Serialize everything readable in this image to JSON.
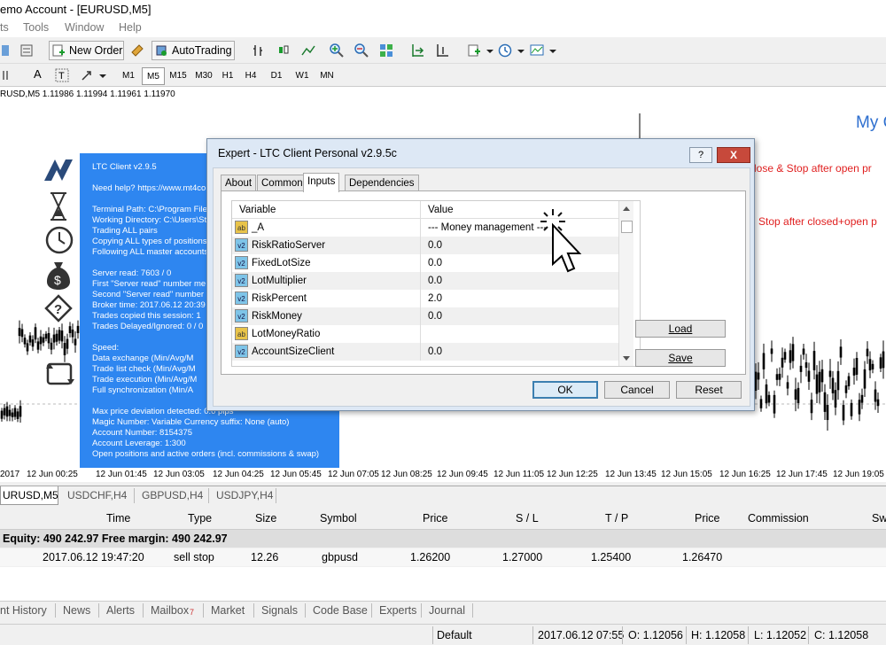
{
  "window": {
    "title": "emo Account - [EURUSD,M5]"
  },
  "menu": [
    "ts",
    "Tools",
    "Window",
    "Help"
  ],
  "toolbar": {
    "new_order": "New Order",
    "autotrading": "AutoTrading"
  },
  "timeframes": [
    "M1",
    "M5",
    "M15",
    "M30",
    "H1",
    "H4",
    "D1",
    "W1",
    "MN"
  ],
  "active_timeframe": "M5",
  "chart": {
    "header": "RUSD,M5  1.11986 1.11994 1.11961 1.11970",
    "right_title": "My C",
    "right_line1": "lose & Stop after open pr",
    "right_line2": "Stop after closed+open p",
    "time_labels": [
      "2017",
      "12 Jun 00:25",
      "12 Jun 01:45",
      "12 Jun 03:05",
      "12 Jun 04:25",
      "12 Jun 05:45",
      "12 Jun 07:05",
      "12 Jun 08:25",
      "12 Jun 09:45",
      "12 Jun 11:05",
      "12 Jun 12:25",
      "12 Jun 13:45",
      "12 Jun 15:05",
      "12 Jun 16:25",
      "12 Jun 17:45",
      "12 Jun 19:05"
    ],
    "colors": {
      "info_panel": "#2e86f0",
      "right_text": "#e02020",
      "right_title": "#2e6fcf"
    }
  },
  "info_panel": {
    "lines": [
      "LTC Client v2.9.5",
      "",
      "Need help? https://www.mt4co",
      "",
      "Terminal Path: C:\\Program File",
      "Working Directory: C:\\Users\\St",
      "Trading ALL pairs",
      "Copying ALL types of positions",
      "Following ALL master accounts",
      "",
      "Server read: 7603 / 0",
      "First \"Server read\" number me",
      "Second \"Server read\" number c",
      "Broker time: 2017.06.12 20:39",
      "Trades copied this session: 1",
      "Trades Delayed/Ignored: 0 / 0",
      "",
      "Speed:",
      "     Data exchange (Min/Avg/M",
      "     Trade list check (Min/Avg/M",
      "     Trade execution (Min/Avg/M",
      "     Full synchronization (Min/A",
      "",
      "Max price deviation detected: 0.0 pips",
      "Magic Number: Variable     Currency suffix: None (auto)",
      "Account Number: 8154375",
      "Account Leverage: 1:300",
      "Open positions and active orders (incl. commissions & swap)"
    ]
  },
  "dialog": {
    "title": "Expert - LTC Client Personal v2.9.5c",
    "help_label": "?",
    "close_label": "X",
    "tabs": [
      "About",
      "Common",
      "Inputs",
      "Dependencies"
    ],
    "active_tab": "Inputs",
    "grid_headers": {
      "variable": "Variable",
      "value": "Value"
    },
    "rows": [
      {
        "icon": "ab",
        "variable": "_A",
        "value": "--- Money management ---"
      },
      {
        "icon": "v2",
        "variable": "RiskRatioServer",
        "value": "0.0"
      },
      {
        "icon": "v2",
        "variable": "FixedLotSize",
        "value": "0.0"
      },
      {
        "icon": "v2",
        "variable": "LotMultiplier",
        "value": "0.0"
      },
      {
        "icon": "v2",
        "variable": "RiskPercent",
        "value": "2.0"
      },
      {
        "icon": "v2",
        "variable": "RiskMoney",
        "value": "0.0"
      },
      {
        "icon": "ab",
        "variable": "LotMoneyRatio",
        "value": ""
      },
      {
        "icon": "v2",
        "variable": "AccountSizeClient",
        "value": "0.0"
      }
    ],
    "buttons": {
      "load": "Load",
      "save": "Save",
      "ok": "OK",
      "cancel": "Cancel",
      "reset": "Reset"
    }
  },
  "chart_tabs": [
    "URUSD,M5",
    "USDCHF,H4",
    "GBPUSD,H4",
    "USDJPY,H4"
  ],
  "terminal": {
    "headers": [
      "Time",
      "Type",
      "Size",
      "Symbol",
      "Price",
      "S / L",
      "T / P",
      "Price",
      "Commission",
      "Sw"
    ],
    "equity_line": "Equity: 490 242.97  Free margin: 490 242.97",
    "order": {
      "time": "2017.06.12 19:47:20",
      "type": "sell stop",
      "size": "12.26",
      "symbol": "gbpusd",
      "price": "1.26200",
      "sl": "1.27000",
      "tp": "1.25400",
      "price2": "1.26470"
    },
    "tabs": [
      "nt History",
      "News",
      "Alerts",
      "Mailbox",
      "Market",
      "Signals",
      "Code Base",
      "Experts",
      "Journal"
    ],
    "mailbox_badge": "7"
  },
  "status": {
    "profile": "Default",
    "datetime": "2017.06.12 07:55",
    "open": "O: 1.12056",
    "high": "H: 1.12058",
    "low": "L: 1.12052",
    "close": "C: 1.12058"
  }
}
